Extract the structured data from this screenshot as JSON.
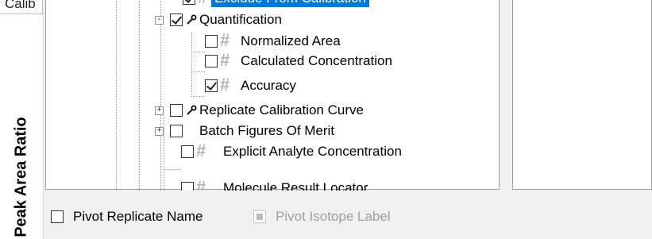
{
  "left_panel": {
    "tab_label": "Calib",
    "axis_label": "Peak Area Ratio"
  },
  "tree": {
    "items": [
      {
        "label": "Exclude From Calibration",
        "checked": true,
        "icon": "hash-icon",
        "selected": true
      },
      {
        "label": "Quantification",
        "checked": true,
        "icon": "link-icon",
        "expander": "-"
      },
      {
        "label": "Normalized Area",
        "checked": false,
        "icon": "hash-icon"
      },
      {
        "label": "Calculated Concentration",
        "checked": false,
        "icon": "hash-icon"
      },
      {
        "label": "Accuracy",
        "checked": true,
        "icon": "hash-icon"
      },
      {
        "label": "Replicate Calibration Curve",
        "checked": false,
        "icon": "link-icon",
        "expander": "+"
      },
      {
        "label": "Batch Figures Of Merit",
        "checked": false,
        "icon": "none",
        "expander": "+"
      },
      {
        "label": "Explicit Analyte Concentration",
        "checked": false,
        "icon": "hash-icon"
      },
      {
        "label": "Molecule Result Locator",
        "checked": false,
        "icon": "hash-icon"
      }
    ]
  },
  "options": {
    "pivot_replicate_label": "Pivot Replicate Name",
    "pivot_isotope_label": "Pivot Isotope Label"
  }
}
